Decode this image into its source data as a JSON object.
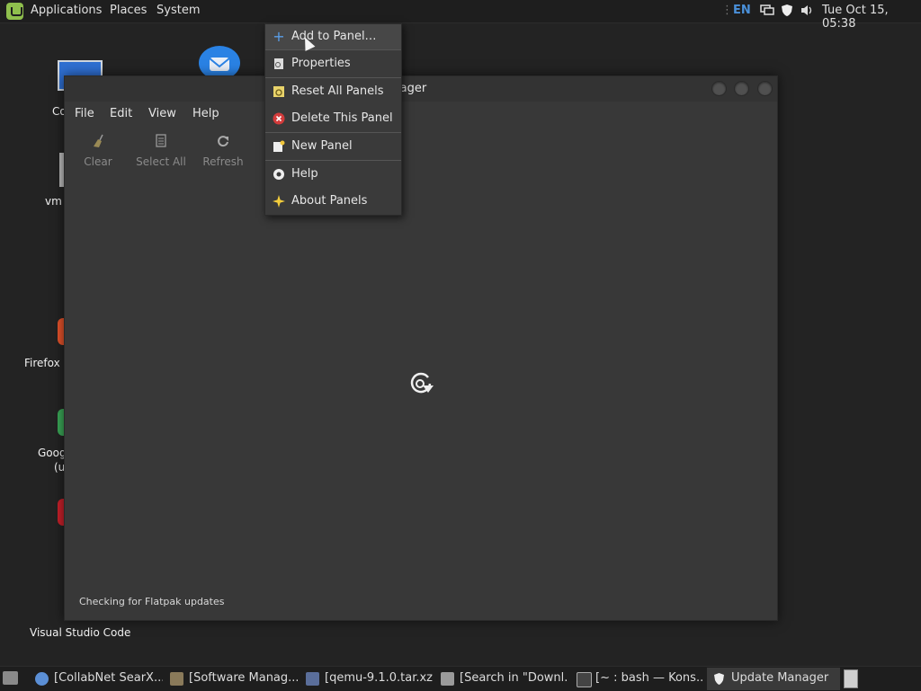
{
  "top_panel": {
    "menus": [
      "Applications",
      "Places",
      "System"
    ],
    "lang": "EN",
    "datetime": "Tue Oct 15, 05:38"
  },
  "desktop_icons": [
    "Co",
    "vm",
    "Firefox",
    "Goog",
    "(u",
    "Visual Studio Code"
  ],
  "window": {
    "title": "ate Manager",
    "menus": [
      "File",
      "Edit",
      "View",
      "Help"
    ],
    "toolbar": [
      "Clear",
      "Select All",
      "Refresh"
    ],
    "status": "Checking for Flatpak updates"
  },
  "context_menu": {
    "items": [
      {
        "label": "Add to Panel…",
        "icon": "plus-icon"
      },
      {
        "label": "Properties",
        "icon": "properties-icon"
      },
      {
        "label": "Reset All Panels",
        "icon": "reset-icon"
      },
      {
        "label": "Delete This Panel",
        "icon": "delete-icon"
      },
      {
        "label": "New Panel",
        "icon": "new-panel-icon"
      },
      {
        "label": "Help",
        "icon": "help-icon"
      },
      {
        "label": "About Panels",
        "icon": "about-icon"
      }
    ]
  },
  "taskbar": {
    "tasks": [
      "[CollabNet SearX...",
      "[Software Manag...",
      "[qemu-9.1.0.tar.xz]",
      "[Search in \"Downl...",
      "[~ : bash — Kons...",
      "Update Manager"
    ]
  }
}
